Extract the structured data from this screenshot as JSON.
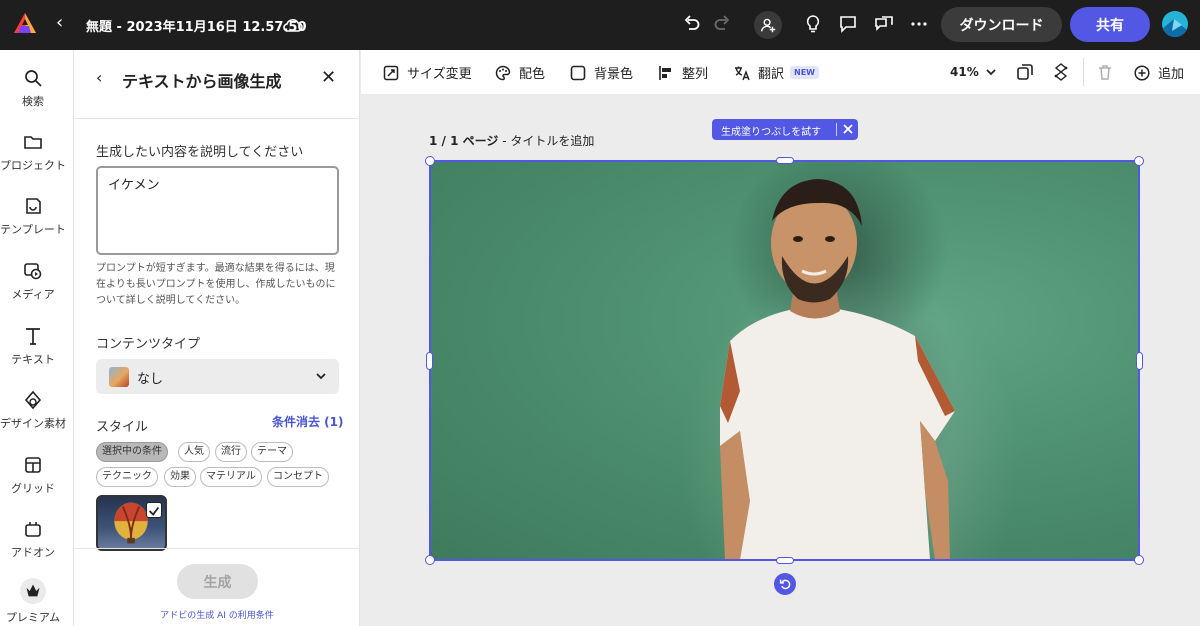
{
  "topbar": {
    "doc_title": "無題 - 2023年11月16日 12.57.50",
    "download_label": "ダウンロード",
    "share_label": "共有",
    "icons": [
      "adobe-express-logo",
      "back-chevron",
      "cloud-icon",
      "undo-icon",
      "redo-icon",
      "invite-user-icon",
      "lightbulb-icon",
      "comment-icon",
      "share-comments-icon",
      "more-icon",
      "avatar"
    ],
    "colors": {
      "bar_bg": "#1e1e1e",
      "share_bg": "#5258e4",
      "download_bg": "#3b3b3b"
    }
  },
  "rail": {
    "items": [
      {
        "label": "検索",
        "icon": "search-icon"
      },
      {
        "label": "プロジェクト",
        "icon": "folder-icon"
      },
      {
        "label": "テンプレート",
        "icon": "template-icon"
      },
      {
        "label": "メディア",
        "icon": "media-icon"
      },
      {
        "label": "テキスト",
        "icon": "text-icon"
      },
      {
        "label": "デザイン素材",
        "icon": "design-assets-icon"
      },
      {
        "label": "グリッド",
        "icon": "grid-icon"
      },
      {
        "label": "アドオン",
        "icon": "addon-icon"
      },
      {
        "label": "プレミアム",
        "icon": "premium-crown-icon"
      }
    ]
  },
  "panel": {
    "title": "テキストから画像生成",
    "prompt_label": "生成したい内容を説明してください",
    "prompt_value": "イケメン",
    "prompt_warning": "プロンプトが短すぎます。最適な結果を得るには、現在よりも長いプロンプトを使用し、作成したいものについて詳しく説明してください。",
    "content_type_label": "コンテンツタイプ",
    "content_type_value": "なし",
    "style_label": "スタイル",
    "style_clear": "条件消去 (1)",
    "chips_row1": [
      "選択中の条件",
      "人気",
      "流行",
      "テーマ"
    ],
    "chips_row2": [
      "テクニック",
      "効果",
      "マテリアル",
      "コンセプト"
    ],
    "generate_label": "生成",
    "terms_link": "アドビの生成 AI の利用条件"
  },
  "canvas_toolbar": {
    "resize": "サイズ変更",
    "color": "配色",
    "background": "背景色",
    "align": "整列",
    "translate": "翻訳",
    "new_badge": "NEW",
    "zoom": "41%",
    "add": "追加"
  },
  "canvas": {
    "page_number": "1 / 1 ページ",
    "page_title_prompt": "- タイトルを追加",
    "fill_prompt": "生成塗りつぶしを試す",
    "photo_description_colors": {
      "background": "#4d8f6f",
      "shirt": "#f1ede8",
      "skin": "#c48d64"
    },
    "accent": "#5258e4"
  }
}
